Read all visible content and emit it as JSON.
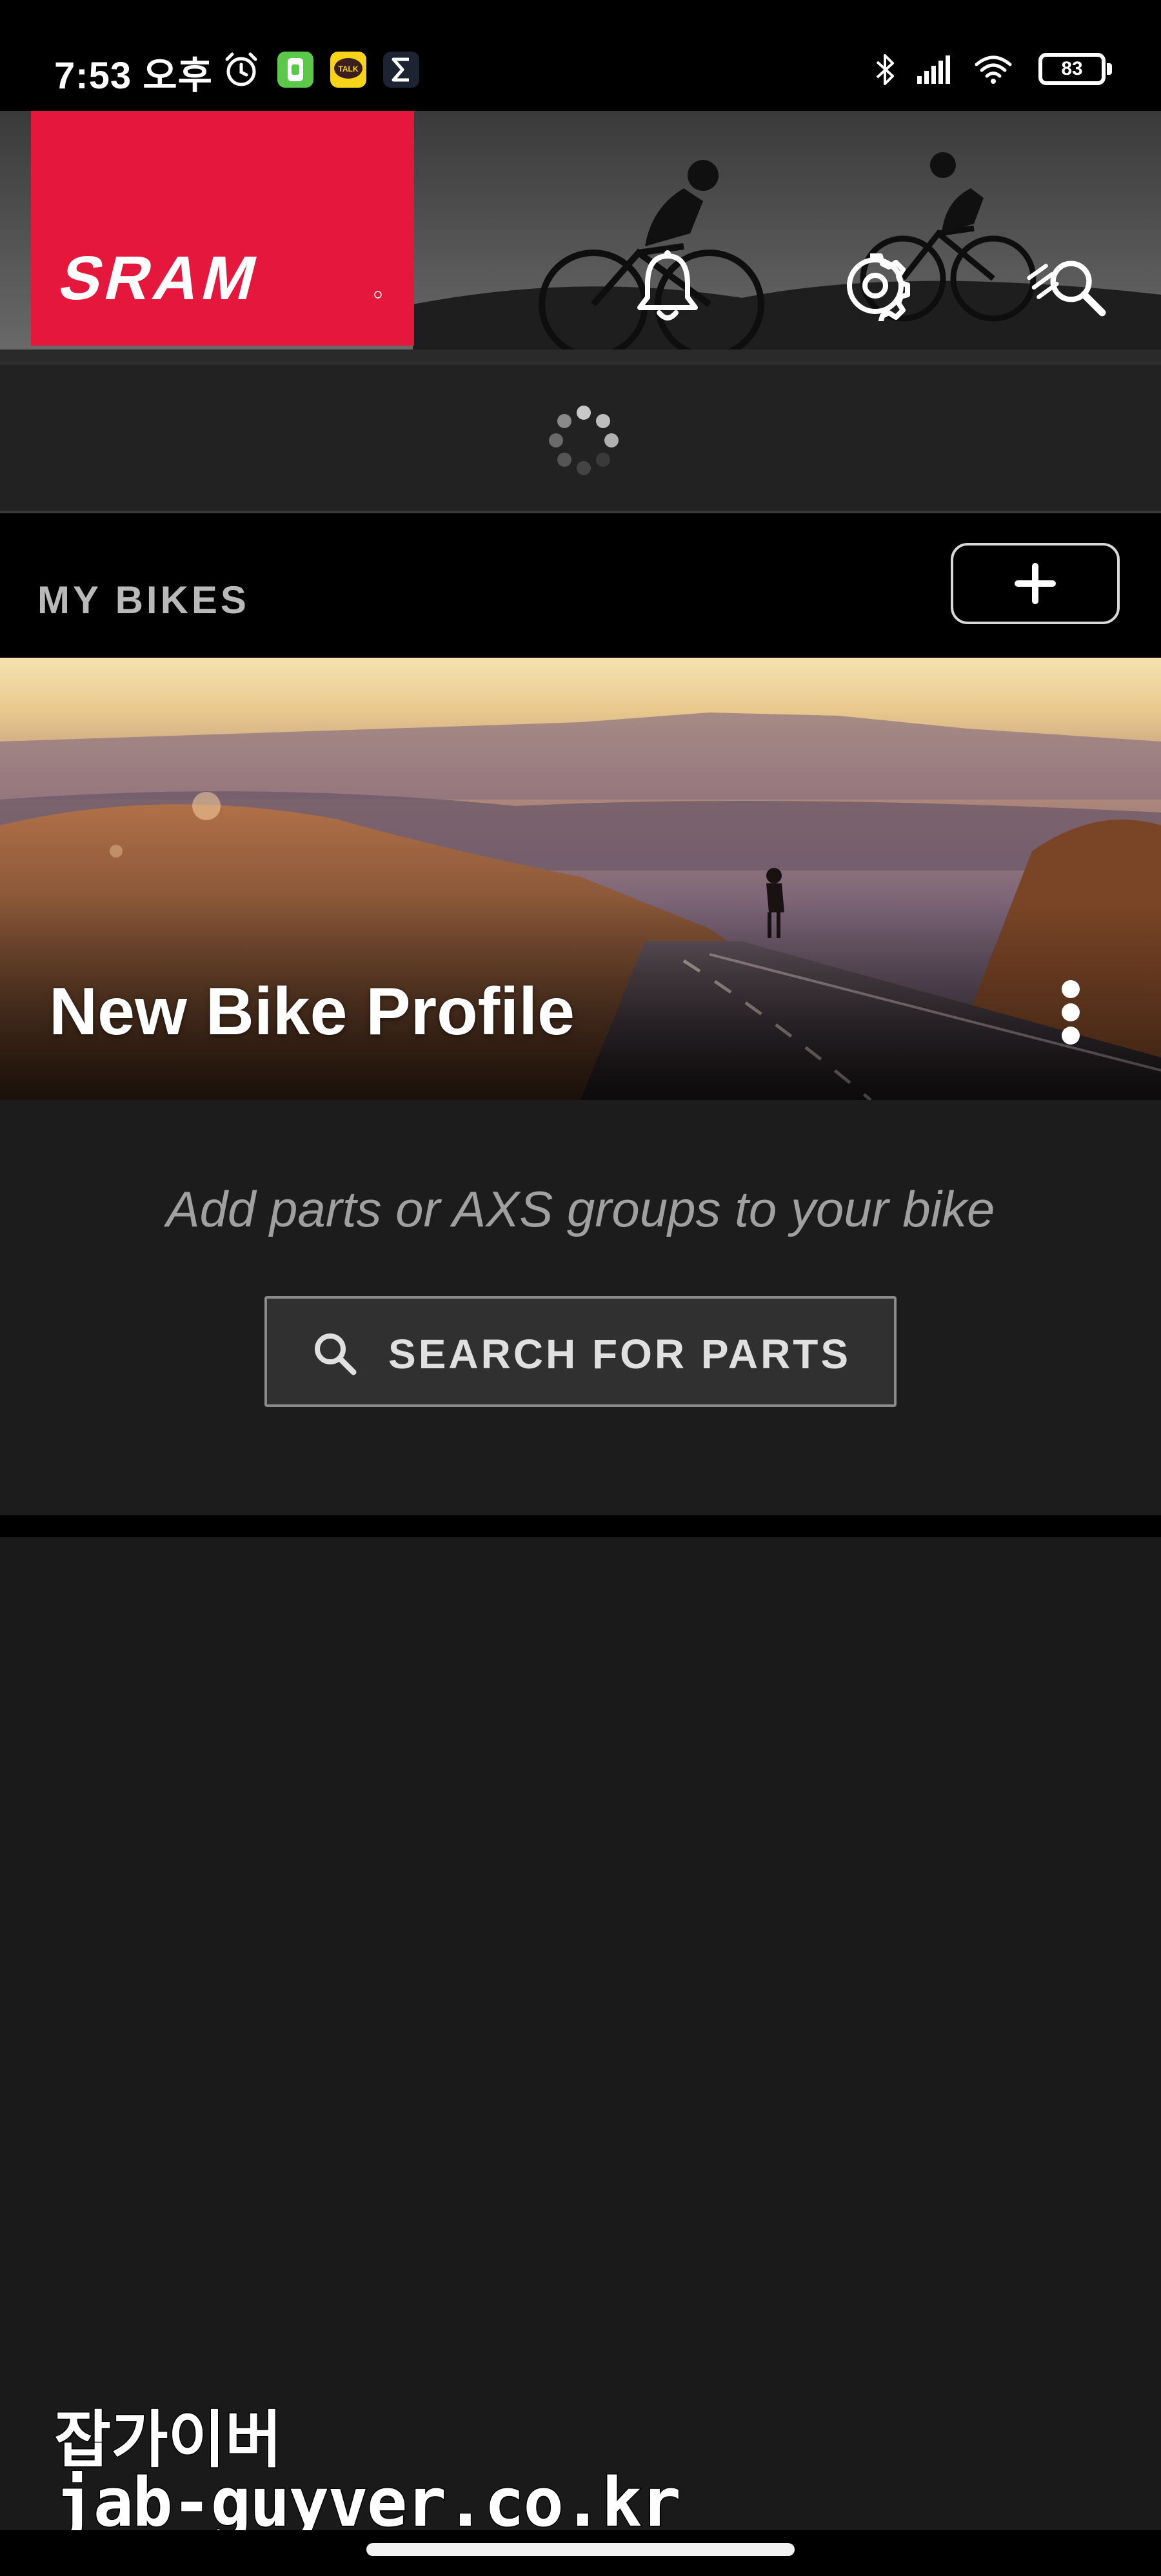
{
  "status_bar": {
    "time": "7:53 오후",
    "battery_level": "83",
    "notification_icons": [
      "alarm-clock-icon",
      "green-app-icon",
      "kakaotalk-icon",
      "sigma-icon"
    ],
    "system_icons": [
      "bluetooth-icon",
      "signal-icon",
      "wifi-icon",
      "battery-icon"
    ],
    "kakaotalk_badge": "TALK"
  },
  "header": {
    "brand": "SRAM",
    "brand_color": "#e5173c",
    "buttons": [
      "notification-bell-icon",
      "settings-gear-icon",
      "search-parts-touch-icon"
    ]
  },
  "my_bikes": {
    "title": "MY BIKES",
    "add_button_icon": "plus-icon"
  },
  "bike_card": {
    "name": "New Bike Profile",
    "hint": "Add parts or AXS groups to your bike",
    "search_button": "SEARCH FOR PARTS"
  },
  "watermark": {
    "name": "잡가이버",
    "url": "jab-guyver.co.kr"
  }
}
